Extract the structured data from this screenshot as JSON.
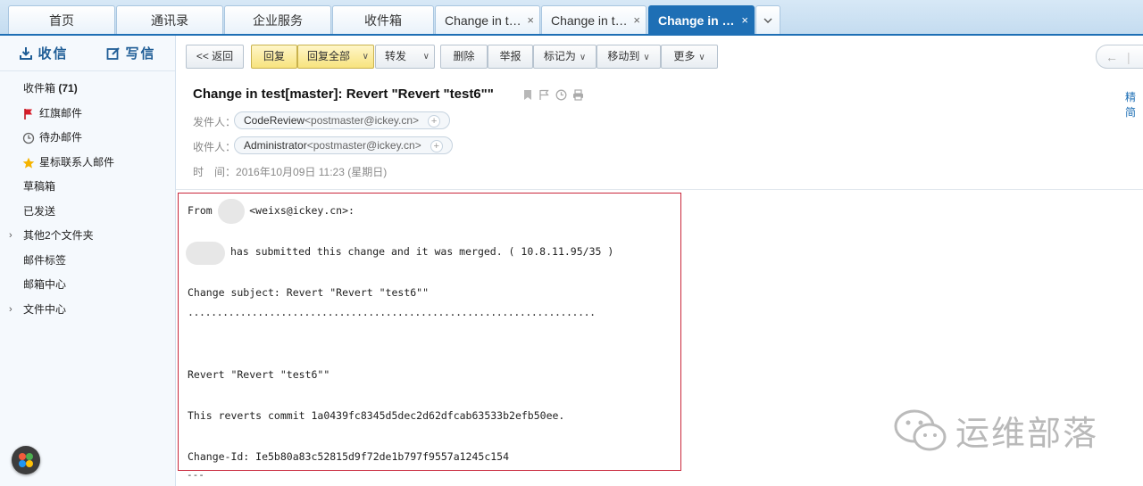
{
  "tabs": [
    {
      "label": "首页"
    },
    {
      "label": "通讯录"
    },
    {
      "label": "企业服务"
    },
    {
      "label": "收件箱"
    },
    {
      "label": "Change in t…"
    },
    {
      "label": "Change in t…"
    },
    {
      "label": "Change in …"
    }
  ],
  "sidebar": {
    "receive_label": "收信",
    "compose_label": "写信",
    "items": [
      {
        "label": "收件箱",
        "count": "(71)"
      },
      {
        "label": "红旗邮件"
      },
      {
        "label": "待办邮件"
      },
      {
        "label": "星标联系人邮件"
      },
      {
        "label": "草稿箱"
      },
      {
        "label": "已发送"
      },
      {
        "label": "其他2个文件夹"
      },
      {
        "label": "邮件标签"
      },
      {
        "label": "邮箱中心"
      },
      {
        "label": "文件中心"
      }
    ]
  },
  "toolbar": {
    "back": "<< 返回",
    "reply": "回复",
    "reply_all": "回复全部",
    "forward": "转发",
    "delete": "删除",
    "report": "举报",
    "mark_as": "标记为",
    "move_to": "移动到",
    "more": "更多"
  },
  "right_link": "精简",
  "email": {
    "subject": "Change in test[master]: Revert \"Revert \"test6\"\"",
    "from_label": "发件人：",
    "from_name": "CodeReview",
    "from_addr": "<postmaster@ickey.cn>",
    "to_label": "收件人：",
    "to_name": "Administrator",
    "to_addr": "<postmaster@ickey.cn>",
    "time_label": "时　间：",
    "time_value": "2016年10月09日 11:23 (星期日)"
  },
  "body": {
    "line1": "From      <weixs@ickey.cn>:",
    "line2": "has submitted this change and it was merged. ( 10.8.11.95/35 )",
    "line3": "Change subject: Revert \"Revert \"test6\"\"",
    "dots": "......................................................................",
    "line4": "Revert \"Revert \"test6\"\"",
    "line5": "This reverts commit 1a0439fc8345d5dec2d62dfcab63533b2efb50ee.",
    "line6": "Change-Id: Ie5b80a83c52815d9f72de1b797f9557a1245c154",
    "trail": "---"
  },
  "watermark": "运维部落",
  "colors": {
    "accent": "#1e6fb5",
    "highlight_border": "#c9273b",
    "highlight_button": "#f7e37e"
  }
}
